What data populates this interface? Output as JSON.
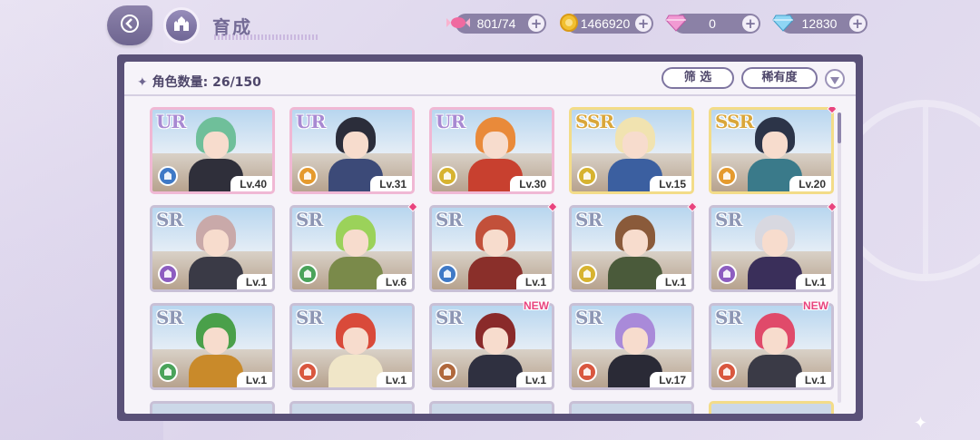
{
  "header": {
    "title": "育成"
  },
  "currencies": [
    {
      "icon": "candy-icon",
      "value": "801/74"
    },
    {
      "icon": "gold-coin-icon",
      "value": "1466920"
    },
    {
      "icon": "pink-gem-icon",
      "value": "0"
    },
    {
      "icon": "blue-diamond-icon",
      "value": "12830"
    }
  ],
  "panel": {
    "count_label": "角色数量: 26/150",
    "filter_label": "筛 选",
    "rarity_sort_label": "稀有度"
  },
  "colors": {
    "attr_blue": "#3f79c6",
    "attr_orange": "#e59a2e",
    "attr_yellow": "#d7b330",
    "attr_purple": "#8d5dc0",
    "attr_green": "#4aa35a",
    "attr_red": "#d9573f",
    "attr_brown": "#b0683c",
    "new_pink": "#e8447e"
  },
  "cards": [
    {
      "rarity": "UR",
      "level": "Lv.40",
      "attr": "blue",
      "hair": "#6fbf9a",
      "outfit": "#2f2f3a",
      "dot": false,
      "new": ""
    },
    {
      "rarity": "UR",
      "level": "Lv.31",
      "attr": "orange",
      "hair": "#2b2d3a",
      "outfit": "#3c4a78",
      "dot": false,
      "new": ""
    },
    {
      "rarity": "UR",
      "level": "Lv.30",
      "attr": "yellow",
      "hair": "#e98a3a",
      "outfit": "#c8402f",
      "dot": false,
      "new": ""
    },
    {
      "rarity": "SSR",
      "level": "Lv.15",
      "attr": "yellow",
      "hair": "#f1e3b0",
      "outfit": "#3b5fa0",
      "dot": false,
      "new": ""
    },
    {
      "rarity": "SSR",
      "level": "Lv.20",
      "attr": "orange",
      "hair": "#2c3448",
      "outfit": "#3a7a8a",
      "dot": true,
      "new": ""
    },
    {
      "rarity": "SR",
      "level": "Lv.1",
      "attr": "purple",
      "hair": "#c9a9a9",
      "outfit": "#3a3a46",
      "dot": false,
      "new": ""
    },
    {
      "rarity": "SR",
      "level": "Lv.6",
      "attr": "green",
      "hair": "#9bd25a",
      "outfit": "#7a8a4a",
      "dot": true,
      "new": ""
    },
    {
      "rarity": "SR",
      "level": "Lv.1",
      "attr": "blue",
      "hair": "#c2503a",
      "outfit": "#8a2f2a",
      "dot": true,
      "new": ""
    },
    {
      "rarity": "SR",
      "level": "Lv.1",
      "attr": "yellow",
      "hair": "#8a5a3a",
      "outfit": "#4a5a3a",
      "dot": true,
      "new": ""
    },
    {
      "rarity": "SR",
      "level": "Lv.1",
      "attr": "purple",
      "hair": "#d8d8e0",
      "outfit": "#3a2f5a",
      "dot": true,
      "new": ""
    },
    {
      "rarity": "SR",
      "level": "Lv.1",
      "attr": "green",
      "hair": "#4aa04a",
      "outfit": "#c98a2a",
      "dot": false,
      "new": ""
    },
    {
      "rarity": "SR",
      "level": "Lv.1",
      "attr": "red",
      "hair": "#d94a3a",
      "outfit": "#f0e6c8",
      "dot": false,
      "new": ""
    },
    {
      "rarity": "SR",
      "level": "Lv.1",
      "attr": "brown",
      "hair": "#8a2a2a",
      "outfit": "#2f3040",
      "dot": false,
      "new": "NEW"
    },
    {
      "rarity": "SR",
      "level": "Lv.17",
      "attr": "red",
      "hair": "#a98ad9",
      "outfit": "#2a2a36",
      "dot": false,
      "new": ""
    },
    {
      "rarity": "SR",
      "level": "Lv.1",
      "attr": "red",
      "hair": "#e04a6a",
      "outfit": "#3a3a46",
      "dot": false,
      "new": "NEW"
    }
  ]
}
